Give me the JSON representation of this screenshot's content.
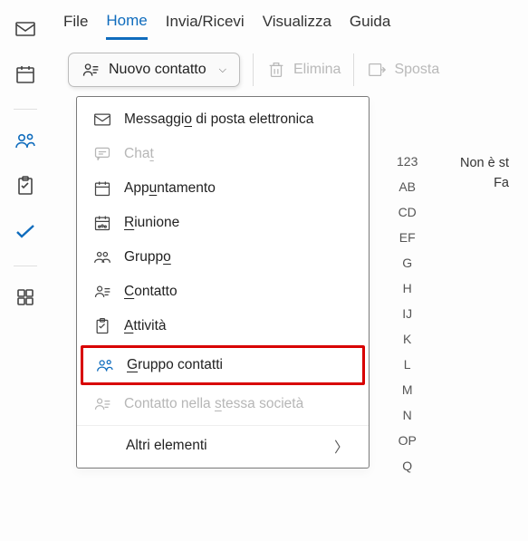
{
  "leftbar": {
    "items": [
      {
        "name": "mail"
      },
      {
        "name": "calendar"
      },
      {
        "name": "people",
        "active": true
      },
      {
        "name": "tasks"
      },
      {
        "name": "todo"
      },
      {
        "name": "apps"
      }
    ]
  },
  "topnav": {
    "tabs": [
      {
        "label": "File"
      },
      {
        "label": "Home",
        "active": true
      },
      {
        "label": "Invia/Ricevi"
      },
      {
        "label": "Visualizza"
      },
      {
        "label": "Guida"
      }
    ]
  },
  "toolbar": {
    "new_contact_label": "Nuovo contatto",
    "delete_label": "Elimina",
    "move_label": "Sposta"
  },
  "dropdown": {
    "items": [
      {
        "icon": "mail",
        "pre": "Messaggi",
        "ukey": "o",
        "post": " di posta elettronica"
      },
      {
        "icon": "chat",
        "pre": "Cha",
        "ukey": "t",
        "post": "",
        "disabled": true
      },
      {
        "icon": "calendar",
        "pre": "App",
        "ukey": "u",
        "post": "ntamento"
      },
      {
        "icon": "meeting",
        "pre": "",
        "ukey": "R",
        "post": "iunione"
      },
      {
        "icon": "group",
        "pre": "Grupp",
        "ukey": "o",
        "post": ""
      },
      {
        "icon": "contact",
        "pre": "",
        "ukey": "C",
        "post": "ontatto"
      },
      {
        "icon": "task",
        "pre": "",
        "ukey": "A",
        "post": "ttività"
      }
    ],
    "highlighted": {
      "icon": "contact-group",
      "pre": "",
      "ukey": "G",
      "post": "ruppo contatti"
    },
    "disabled_last": {
      "icon": "company",
      "pre": "Contatto nella ",
      "ukey": "s",
      "post": "tessa società"
    },
    "more_label": "Altri elementi"
  },
  "alpha_index": [
    "123",
    "AB",
    "CD",
    "EF",
    "G",
    "H",
    "IJ",
    "K",
    "L",
    "M",
    "N",
    "OP",
    "Q"
  ],
  "empty": {
    "line1": "Non è st",
    "line2": "Fa"
  }
}
